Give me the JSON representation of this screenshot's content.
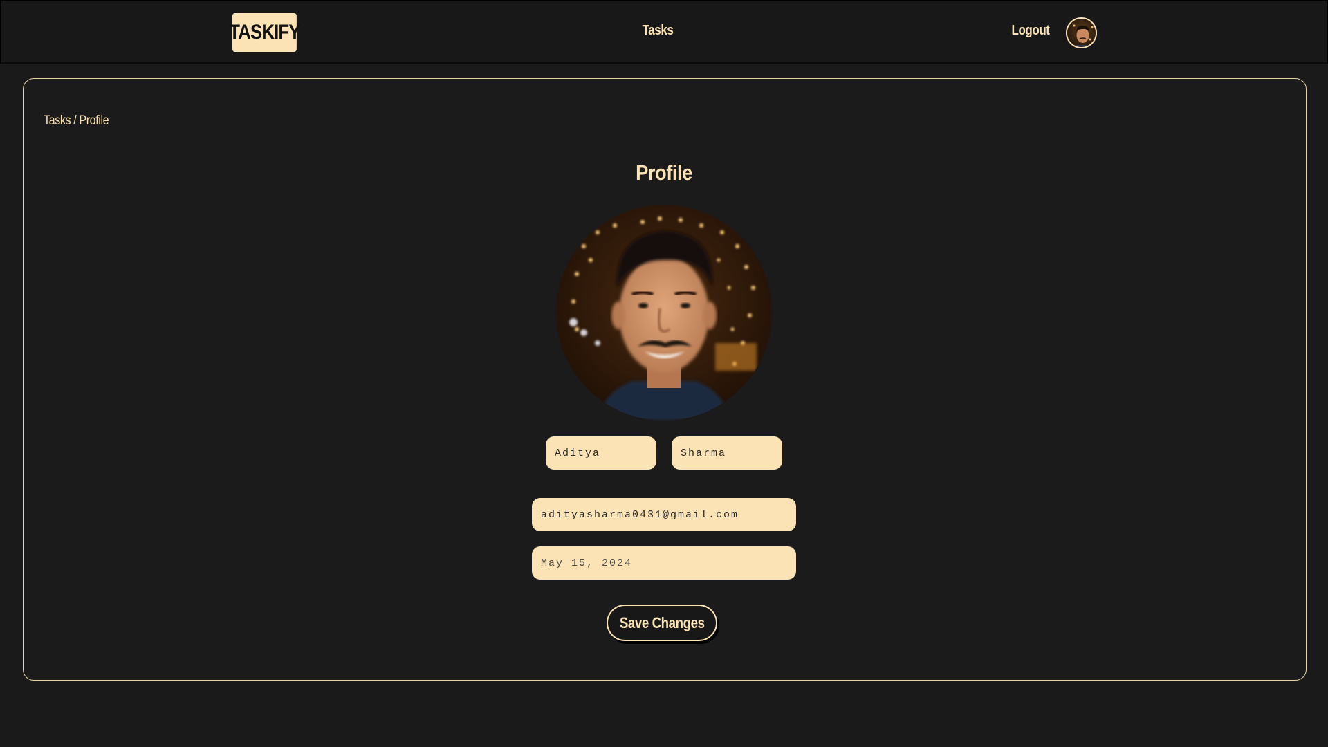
{
  "navbar": {
    "logo": "TASKIFY",
    "tasks_link": "Tasks",
    "logout_link": "Logout"
  },
  "breadcrumb": {
    "items": [
      "Tasks",
      "Profile"
    ],
    "separator": "/"
  },
  "profile": {
    "title": "Profile",
    "first_name": "Aditya",
    "last_name": "Sharma",
    "email": "adityasharma0431@gmail.com",
    "date_placeholder": "May 15, 2024",
    "save_label": "Save Changes"
  },
  "colors": {
    "background": "#1a1a1a",
    "accent": "#fce3b6",
    "card_border": "#e9d3a4"
  }
}
